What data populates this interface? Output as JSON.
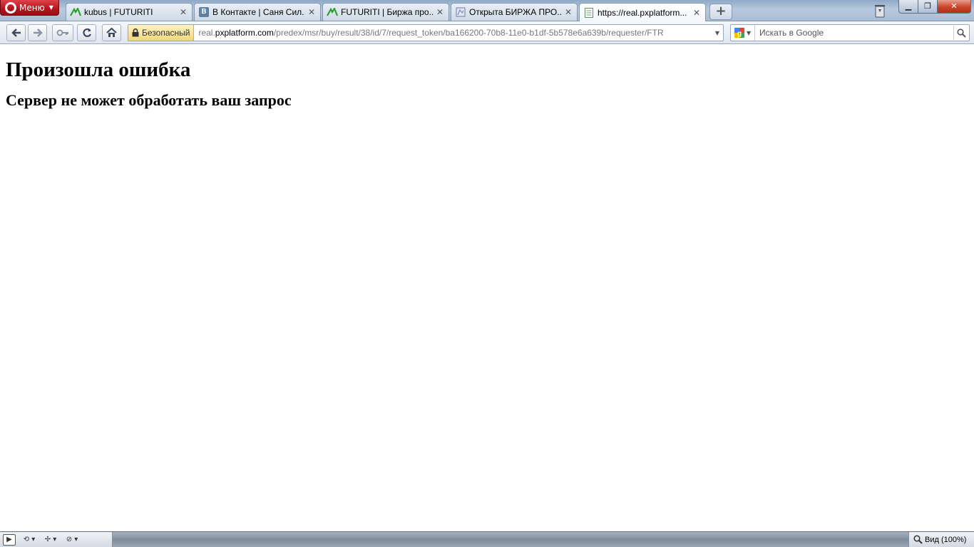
{
  "browser": {
    "menu_label": "Меню",
    "tabs": [
      {
        "title": "kubus | FUTURITI",
        "favicon": "futuriti-icon"
      },
      {
        "title": "В Контакте | Саня Сил...",
        "favicon": "vk-icon",
        "favicon_text": "B"
      },
      {
        "title": "FUTURITI | Биржа про...",
        "favicon": "futuriti-icon"
      },
      {
        "title": "Открыта БИРЖА ПРО...",
        "favicon": "page-icon"
      },
      {
        "title": "https://real.pxplatform...",
        "favicon": "document-icon",
        "active": true
      }
    ],
    "new_tab_symbol": "+",
    "address": {
      "security_label": "Безопасный",
      "url_prefix": "real.",
      "url_host": "pxplatform.com",
      "url_path": "/predex/msr/buy/result/38/id/7/request_token/ba166200-70b8-11e0-b1df-5b578e6a639b/requester/FTR"
    },
    "search": {
      "placeholder": "Искать в Google",
      "value": ""
    },
    "status_bar": {
      "zoom_label": "Вид (100%)"
    }
  },
  "page": {
    "heading": "Произошла ошибка",
    "subheading": "Сервер не может обработать ваш запрос"
  },
  "colors": {
    "menu_red": "#b5141d",
    "tabbar_blue": "#a9bdd3",
    "secure_yellow": "#f1d77c",
    "futuriti_green": "#2aa52a"
  }
}
